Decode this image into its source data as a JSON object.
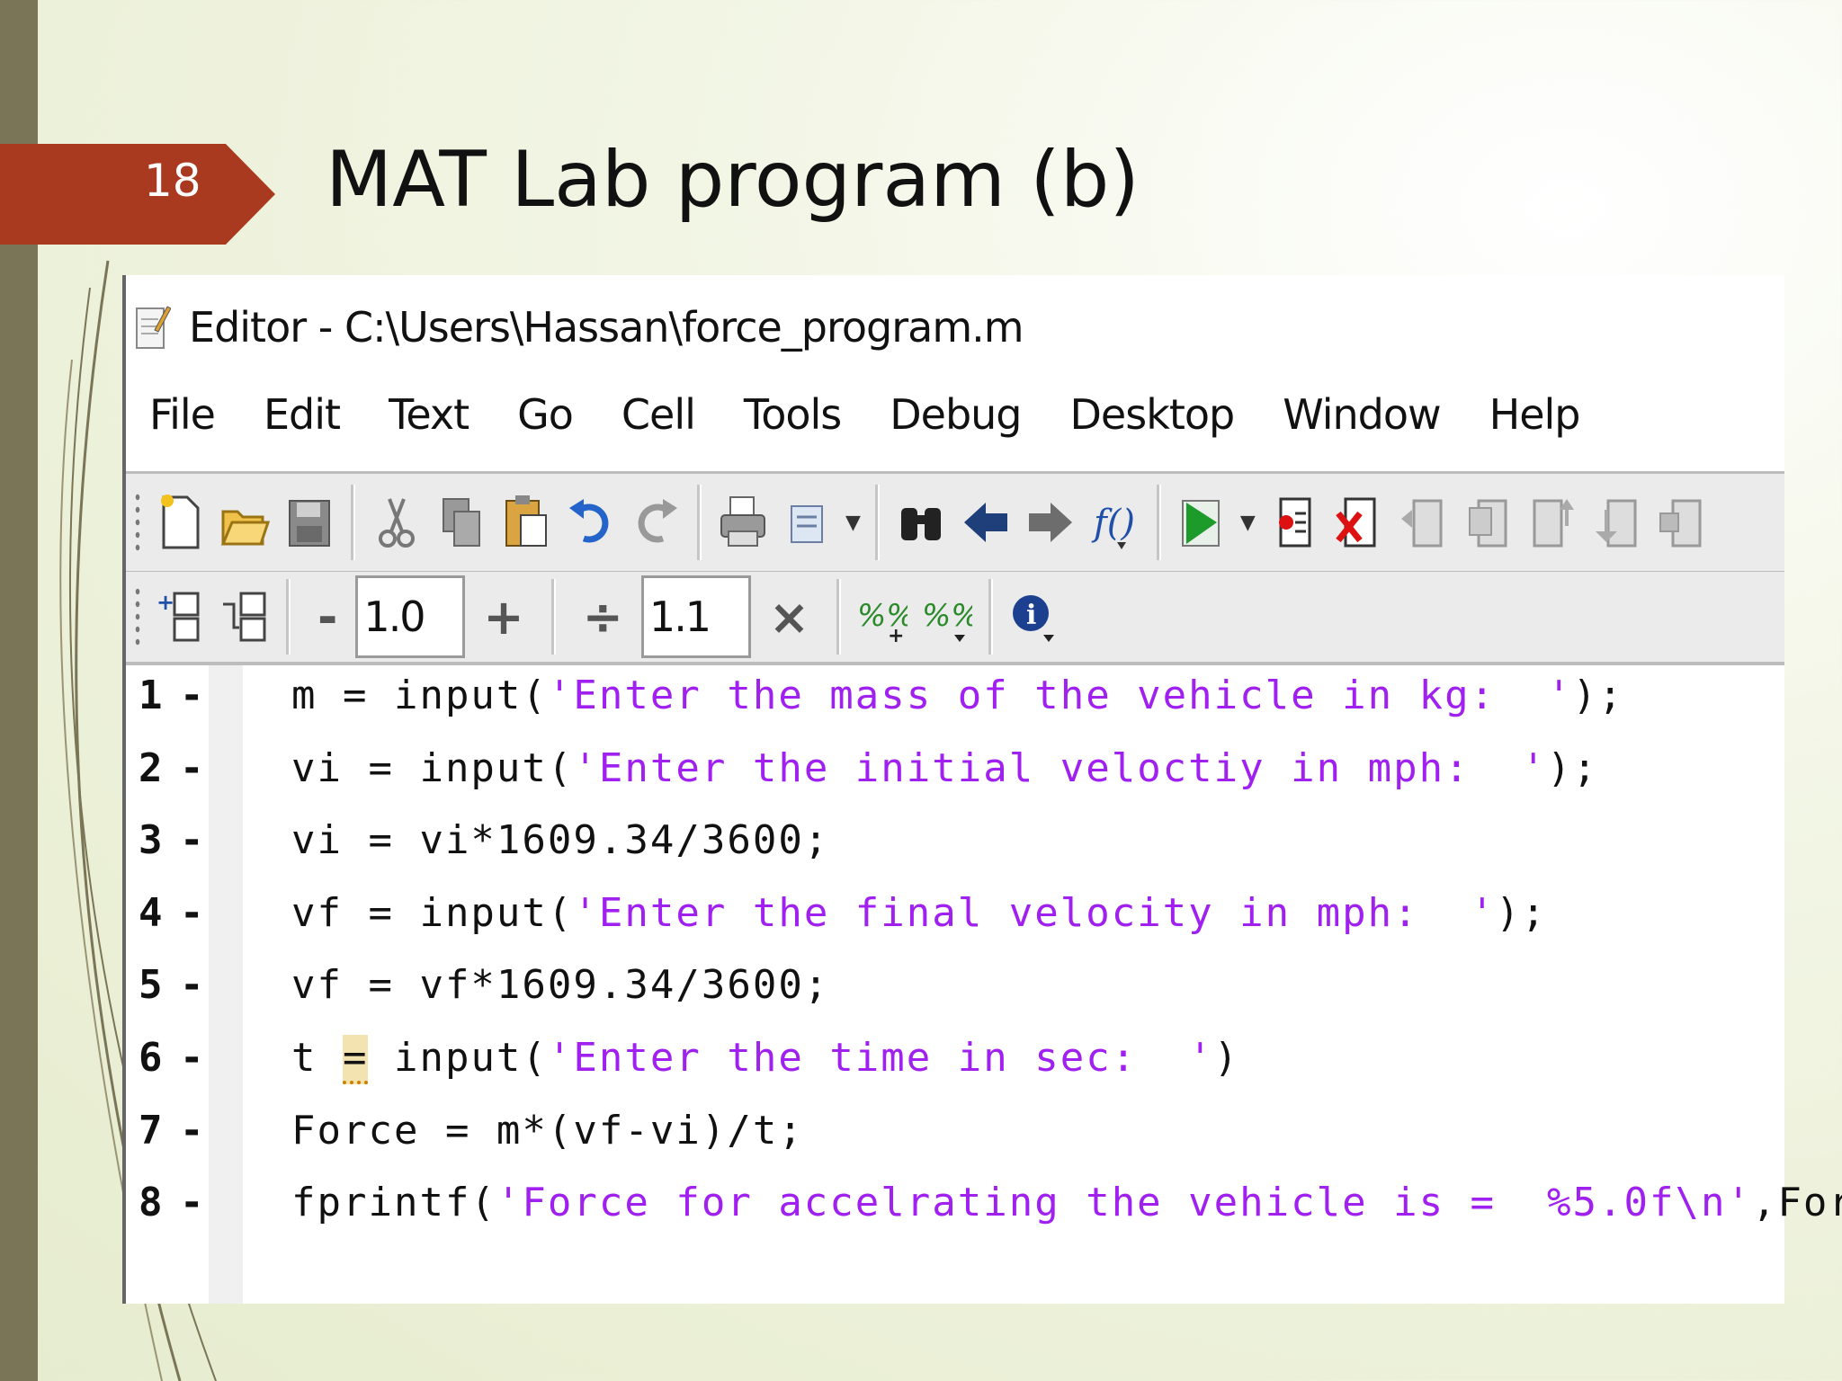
{
  "slide": {
    "number": "18",
    "title": "MAT Lab program (b)"
  },
  "editor": {
    "window_title": "Editor - C:\\Users\\Hassan\\force_program.m",
    "menu": [
      "File",
      "Edit",
      "Text",
      "Go",
      "Cell",
      "Tools",
      "Debug",
      "Desktop",
      "Window",
      "Help"
    ],
    "cell_toolbar": {
      "decrement_label": "-",
      "field1_value": "1.0",
      "increment_label": "+",
      "divide_label": "÷",
      "field2_value": "1.1",
      "multiply_label": "×"
    },
    "lines": [
      {
        "num": "1",
        "marker": "-",
        "pre": "m = input(",
        "str": "'Enter the mass of the vehicle in kg:  '",
        "post": ");"
      },
      {
        "num": "2",
        "marker": "-",
        "pre": "vi = input(",
        "str": "'Enter the initial veloctiy in mph:  '",
        "post": ");"
      },
      {
        "num": "3",
        "marker": "-",
        "pre": "vi = vi*1609.34/3600;",
        "str": "",
        "post": ""
      },
      {
        "num": "4",
        "marker": "-",
        "pre": "vf = input(",
        "str": "'Enter the final velocity in mph:  '",
        "post": ");"
      },
      {
        "num": "5",
        "marker": "-",
        "pre": "vf = vf*1609.34/3600;",
        "str": "",
        "post": ""
      },
      {
        "num": "6",
        "marker": "-",
        "pre_a": "t ",
        "warn": "=",
        "pre_b": " input(",
        "str": "'Enter the time in sec:  '",
        "post": ")"
      },
      {
        "num": "7",
        "marker": "-",
        "pre": "Force = m*(vf-vi)/t;",
        "str": "",
        "post": ""
      },
      {
        "num": "8",
        "marker": "-",
        "pre": "fprintf(",
        "str": "'Force for accelrating the vehicle is =  %5.0f\\n'",
        "post": ",Force)"
      }
    ]
  }
}
